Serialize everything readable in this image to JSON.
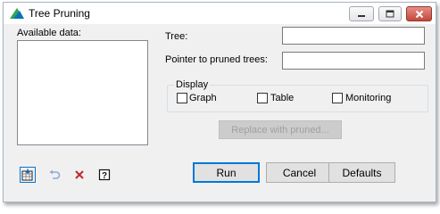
{
  "window": {
    "title": "Tree Pruning",
    "controls": {
      "minimize_icon": "minimize-icon",
      "maximize_icon": "maximize-icon",
      "close_icon": "close-icon"
    }
  },
  "available_data": {
    "label": "Available data:"
  },
  "fields": {
    "tree": {
      "label": "Tree:",
      "value": ""
    },
    "pointer": {
      "label": "Pointer to pruned trees:",
      "value": ""
    }
  },
  "display": {
    "label": "Display",
    "options": [
      {
        "label": "Graph",
        "checked": false
      },
      {
        "label": "Table",
        "checked": false
      },
      {
        "label": "Monitoring",
        "checked": false
      }
    ]
  },
  "replace_button": {
    "label": "Replace with pruned..."
  },
  "buttons": {
    "run": "Run",
    "cancel": "Cancel",
    "defaults": "Defaults"
  },
  "toolbar": [
    "save-to-spreadsheet-icon",
    "undo-icon",
    "clear-icon",
    "help-icon"
  ],
  "colors": {
    "close_red": "#c4473b",
    "default_border": "#0078d7",
    "disabled_text": "#a0a0a0"
  }
}
